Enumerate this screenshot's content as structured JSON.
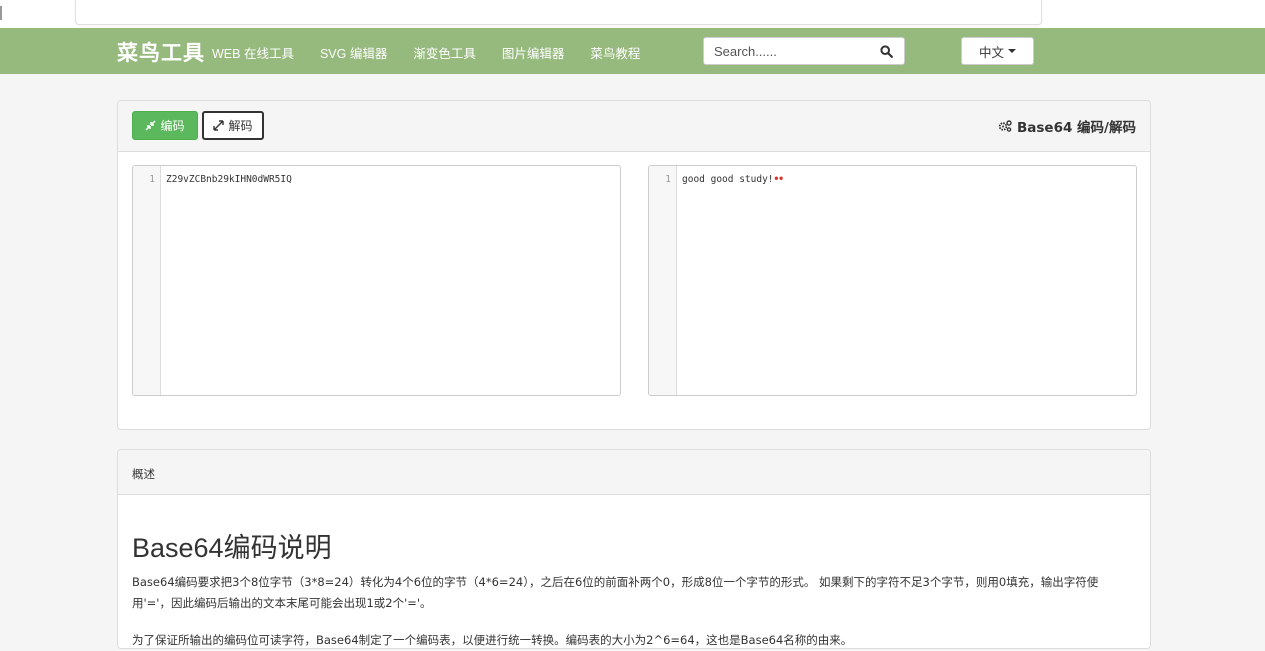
{
  "navbar": {
    "brand": "菜鸟工具",
    "links": [
      "WEB 在线工具",
      "SVG 编辑器",
      "渐变色工具",
      "图片编辑器",
      "菜鸟教程"
    ],
    "search_placeholder": "Search......",
    "language": "中文"
  },
  "tool": {
    "encode_label": "编码",
    "decode_label": "解码",
    "title": "Base64 编码/解码",
    "left_editor": {
      "line_number": "1",
      "content": "Z29vZCBnb29kIHN0dWR5IQ"
    },
    "right_editor": {
      "line_number": "1",
      "content": "good good study!",
      "trailing_marker": "••"
    }
  },
  "overview": {
    "header": "概述",
    "heading": "Base64编码说明",
    "paragraph": "Base64编码要求把3个8位字节（3*8=24）转化为4个6位的字节（4*6=24），之后在6位的前面补两个0，形成8位一个字节的形式。 如果剩下的字符不足3个字节，则用0填充，输出字符使用'='，因此编码后输出的文本末尾可能会出现1或2个'='。",
    "paragraph2": "为了保证所输出的编码位可读字符，Base64制定了一个编码表，以便进行统一转换。编码表的大小为2^6=64，这也是Base64名称的由来。"
  },
  "colors": {
    "navbar": "#96b97d",
    "encode_button": "#5cb85c",
    "marker": "#d9342b"
  }
}
